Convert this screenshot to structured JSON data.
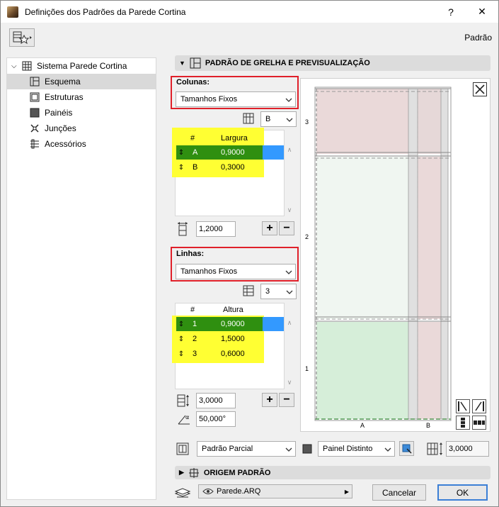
{
  "window": {
    "title": "Definições dos Padrões da Parede Cortina",
    "help": "?",
    "close": "✕"
  },
  "topbar": {
    "preset_label": "Padrão"
  },
  "tree": {
    "root": "Sistema Parede Cortina",
    "items": [
      {
        "label": "Esquema",
        "selected": true
      },
      {
        "label": "Estruturas"
      },
      {
        "label": "Painéis"
      },
      {
        "label": "Junções"
      },
      {
        "label": "Acessórios"
      }
    ]
  },
  "section_grid": {
    "title": "PADRÃO DE GRELHA E PREVISUALIZAÇÃO"
  },
  "columns": {
    "label": "Colunas:",
    "mode": "Tamanhos Fixos",
    "pattern_select": "B",
    "table_headers": {
      "num": "#",
      "size": "Largura"
    },
    "rows": [
      {
        "id": "A",
        "value": "0,9000"
      },
      {
        "id": "B",
        "value": "0,3000"
      }
    ],
    "total": "1,2000"
  },
  "rows_section": {
    "label": "Linhas:",
    "mode": "Tamanhos Fixos",
    "pattern_select": "3",
    "table_headers": {
      "num": "#",
      "size": "Altura"
    },
    "rows": [
      {
        "id": "1",
        "value": "0,9000"
      },
      {
        "id": "2",
        "value": "1,5000"
      },
      {
        "id": "3",
        "value": "0,6000"
      }
    ],
    "total": "3,0000",
    "angle": "50,000°"
  },
  "preview": {
    "row_labels": [
      "3",
      "2",
      "1"
    ],
    "col_labels": [
      "A",
      "B"
    ]
  },
  "bottom": {
    "pattern_mode": "Padrão Parcial",
    "panel_mode": "Painel Distinto",
    "height": "3,0000"
  },
  "section_origin": {
    "title": "ORIGEM PADRÃO"
  },
  "footer": {
    "layer": "Parede.ARQ",
    "cancel": "Cancelar",
    "ok": "OK"
  },
  "colors": {
    "highlight": "#ffff33",
    "selected_green": "#2f8f10",
    "selected_blue": "#3399ff",
    "red_frame": "#e0202a"
  }
}
